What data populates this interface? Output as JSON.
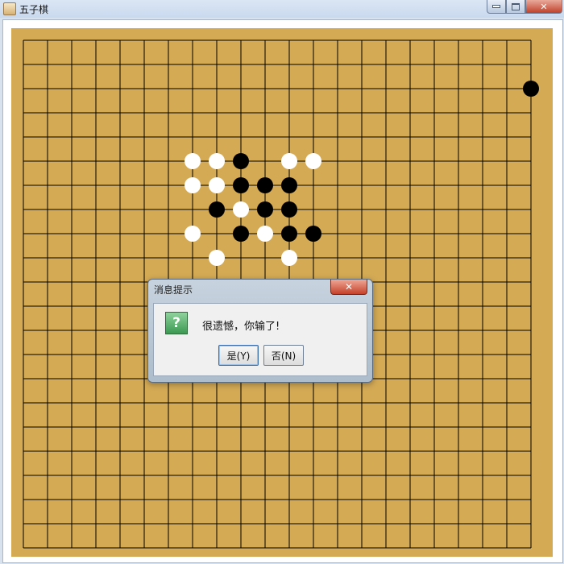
{
  "window": {
    "title": "五子棋",
    "icon": "java-coffee-icon"
  },
  "board": {
    "size": 22,
    "background": "#d4aa55",
    "line_color": "#000000",
    "black_stones": [
      [
        21,
        2
      ],
      [
        9,
        5
      ],
      [
        9,
        6
      ],
      [
        10,
        6
      ],
      [
        11,
        6
      ],
      [
        8,
        7
      ],
      [
        10,
        7
      ],
      [
        11,
        7
      ],
      [
        9,
        8
      ],
      [
        11,
        8
      ],
      [
        12,
        8
      ]
    ],
    "white_stones": [
      [
        7,
        5
      ],
      [
        8,
        5
      ],
      [
        11,
        5
      ],
      [
        12,
        5
      ],
      [
        7,
        6
      ],
      [
        8,
        6
      ],
      [
        9,
        7
      ],
      [
        7,
        8
      ],
      [
        10,
        8
      ],
      [
        8,
        9
      ],
      [
        11,
        9
      ]
    ]
  },
  "dialog": {
    "title": "消息提示",
    "icon": "question-icon",
    "message": "很遗憾，你输了!",
    "yes_label": "是(Y)",
    "no_label": "否(N)"
  }
}
